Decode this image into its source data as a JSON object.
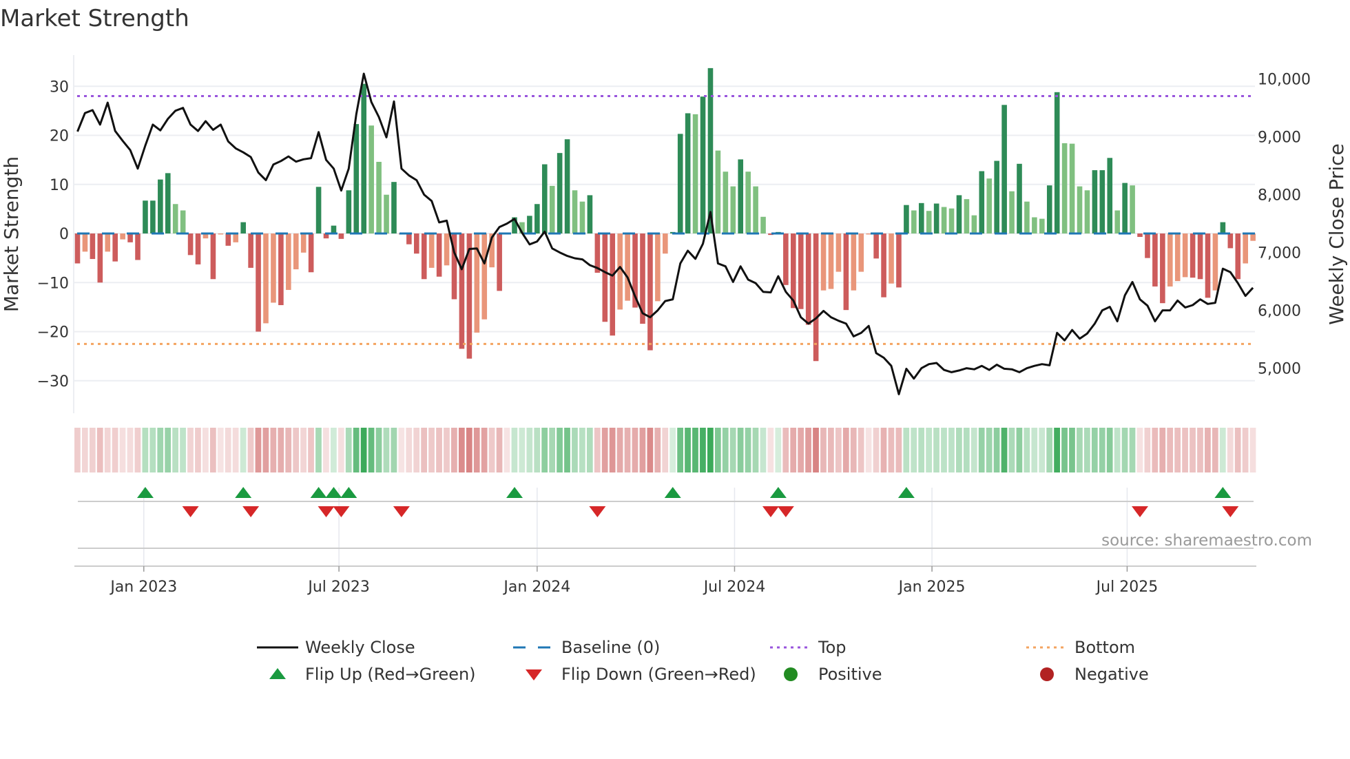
{
  "chart_data": {
    "type": "bar",
    "title": "Market Strength",
    "ylabel": "Market Strength",
    "y2label": "Weekly Close Price",
    "ylim": [
      -36,
      36
    ],
    "y2ticks": [
      5000,
      6000,
      7000,
      8000,
      9000,
      10000
    ],
    "y2tick_labels": [
      "5,000",
      "6,000",
      "7,000",
      "8,000",
      "9,000",
      "10,000"
    ],
    "yticks": [
      -30,
      -20,
      -10,
      0,
      10,
      20,
      30
    ],
    "ytick_labels": [
      "−30",
      "−20",
      "−10",
      "0",
      "10",
      "20",
      "30"
    ],
    "top_level": 28,
    "bottom_level": -22.5,
    "baseline": 0,
    "x_unit": "week index",
    "xticks": [
      {
        "pos": 8.8,
        "label": "Jan 2023"
      },
      {
        "pos": 34.7,
        "label": "Jul 2023"
      },
      {
        "pos": 61.0,
        "label": "Jan 2024"
      },
      {
        "pos": 87.2,
        "label": "Jul 2024"
      },
      {
        "pos": 113.4,
        "label": "Jan 2025"
      },
      {
        "pos": 139.3,
        "label": "Jul 2025"
      }
    ],
    "strength": [
      -6.1,
      -3.7,
      -5.2,
      -10,
      -3.7,
      -5.7,
      -1.2,
      -1.8,
      -5.4,
      6.7,
      6.7,
      11,
      12.3,
      6,
      4.7,
      -4.4,
      -6.3,
      -1,
      -9.3,
      -0.2,
      -2.5,
      -1.8,
      2.3,
      -7,
      -20,
      -18.3,
      -14.1,
      -14.6,
      -11.5,
      -7.3,
      -3.9,
      -7.9,
      9.5,
      -1,
      1.6,
      -1.1,
      8.8,
      22.3,
      30.5,
      22,
      14.6,
      7.9,
      10.5,
      -0.2,
      -2.2,
      -4.1,
      -9.3,
      -7,
      -8.8,
      -6.5,
      -13.4,
      -23.5,
      -25.5,
      -20.2,
      -17.5,
      -6.9,
      -11.7,
      -0.2,
      3.3,
      2.3,
      3.6,
      6,
      14.1,
      9.7,
      16.4,
      19.2,
      8.8,
      6.5,
      7.8,
      -8,
      -18,
      -20.8,
      -15.5,
      -13.7,
      -15.1,
      -18.4,
      -23.8,
      -13.8,
      -4.1,
      0.3,
      20.3,
      24.5,
      24.3,
      27.9,
      33.7,
      16.9,
      12.6,
      9.6,
      15.1,
      12.6,
      9.6,
      3.4,
      -0.3,
      0.3,
      -10.5,
      -15.2,
      -15.4,
      -18.6,
      -26,
      -11.6,
      -11.3,
      -7.8,
      -15.6,
      -11.6,
      -7.8,
      -0.2,
      -5.1,
      -13,
      -10.2,
      -11,
      5.8,
      4.7,
      6.2,
      4.6,
      6.1,
      5.4,
      5.1,
      7.8,
      7,
      3.7,
      12.7,
      11.2,
      14.8,
      26.2,
      8.6,
      14.2,
      6.5,
      3.3,
      3,
      9.8,
      28.8,
      18.4,
      18.3,
      9.6,
      8.8,
      12.9,
      12.9,
      15.4,
      4.7,
      10.3,
      9.8,
      -0.7,
      -5,
      -10.8,
      -14.2,
      -10.8,
      -9.7,
      -8.9,
      -9,
      -9.3,
      -13.1,
      -11.6,
      2.3,
      -3,
      -9.3,
      -6.1,
      -1.5
    ],
    "weekly_close": [
      9090,
      9410,
      9460,
      9210,
      9590,
      9100,
      8930,
      8770,
      8450,
      8850,
      9210,
      9110,
      9310,
      9450,
      9500,
      9210,
      9100,
      9270,
      9120,
      9210,
      8920,
      8800,
      8730,
      8650,
      8380,
      8250,
      8520,
      8580,
      8660,
      8570,
      8610,
      8630,
      9080,
      8600,
      8450,
      8070,
      8450,
      9390,
      10090,
      9600,
      9340,
      8990,
      9610,
      8450,
      8330,
      8250,
      8000,
      7890,
      7520,
      7550,
      7000,
      6710,
      7060,
      7070,
      6810,
      7260,
      7440,
      7500,
      7580,
      7340,
      7140,
      7190,
      7360,
      7070,
      7000,
      6940,
      6900,
      6880,
      6780,
      6730,
      6660,
      6600,
      6750,
      6570,
      6240,
      5950,
      5880,
      6000,
      6160,
      6190,
      6810,
      7030,
      6890,
      7150,
      7700,
      6810,
      6760,
      6490,
      6760,
      6530,
      6470,
      6320,
      6310,
      6590,
      6320,
      6170,
      5880,
      5770,
      5860,
      5990,
      5880,
      5820,
      5770,
      5550,
      5610,
      5730,
      5260,
      5180,
      5040,
      4550,
      4990,
      4820,
      5000,
      5070,
      5090,
      4970,
      4930,
      4960,
      5000,
      4980,
      5040,
      4970,
      5060,
      4990,
      4980,
      4930,
      5000,
      5040,
      5070,
      5050,
      5610,
      5480,
      5660,
      5510,
      5600,
      5770,
      6000,
      6060,
      5810,
      6260,
      6490,
      6190,
      6080,
      5810,
      6000,
      6000,
      6170,
      6050,
      6090,
      6190,
      6110,
      6130,
      6720,
      6660,
      6470,
      6250,
      6390
    ],
    "flip_up_weeks": [
      9,
      22,
      32,
      34,
      36,
      58,
      79,
      93,
      110,
      152
    ],
    "flip_down_weeks": [
      15,
      23,
      33,
      35,
      43,
      69,
      92,
      94,
      141,
      153
    ],
    "legend": [
      {
        "label": "Weekly Close",
        "kind": "line"
      },
      {
        "label": "Baseline (0)",
        "kind": "dash"
      },
      {
        "label": "Top",
        "kind": "dot-purple"
      },
      {
        "label": "Bottom",
        "kind": "dot-orange"
      },
      {
        "label": "Flip Up (Red→Green)",
        "kind": "tri-up"
      },
      {
        "label": "Flip Down (Green→Red)",
        "kind": "tri-down"
      },
      {
        "label": "Positive",
        "kind": "dot-green"
      },
      {
        "label": "Negative",
        "kind": "dot-red"
      }
    ],
    "legend_placement": "bottom"
  },
  "source": "source: sharemaestro.com",
  "colors": {
    "pos_strong": "#2e8b57",
    "pos_weak": "#80c080",
    "neg_strong": "#cd5c5c",
    "neg_weak": "#e9967a",
    "baseline": "#1f77b4",
    "top": "#9955dd",
    "bottom": "#f4a460",
    "flip_up": "#1a9a40",
    "flip_down": "#d62728",
    "positive": "#228b22",
    "negative": "#b22222"
  }
}
